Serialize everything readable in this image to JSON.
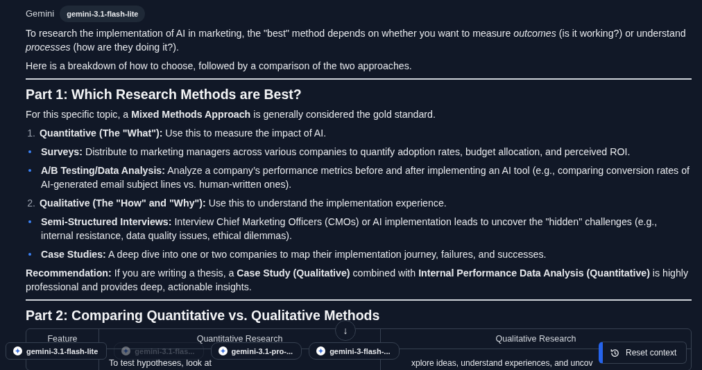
{
  "header": {
    "sender": "Gemini",
    "model_badge": "gemini-3.1-flash-lite"
  },
  "intro": [
    "To research the implementation of AI in marketing, the \"best\" method depends on whether you want to measure *outcomes* (is it working?) or understand *processes* (how are they doing it?).",
    "Here is a breakdown of how to choose, followed by a comparison of the two approaches."
  ],
  "sections": [
    {
      "heading": "Part 1: Which Research Methods are Best?",
      "blocks": [
        {
          "kind": "paragraph",
          "text": "For this specific topic, a **Mixed Methods Approach** is generally considered the gold standard."
        },
        {
          "kind": "numbered",
          "number": "1.",
          "text": "**Quantitative (The \"What\"):** Use this to measure the impact of AI."
        },
        {
          "kind": "bullet",
          "text": "**Surveys:** Distribute to marketing managers across various companies to quantify adoption rates, budget allocation, and perceived ROI."
        },
        {
          "kind": "bullet",
          "text": "**A/B Testing/Data Analysis:** Analyze a company’s performance metrics before and after implementing an AI tool (e.g., comparing conversion rates of AI-generated email subject lines vs. human-written ones)."
        },
        {
          "kind": "numbered",
          "number": "2.",
          "text": "**Qualitative (The \"How\" and \"Why\"):** Use this to understand the implementation experience."
        },
        {
          "kind": "bullet",
          "text": "**Semi-Structured Interviews:** Interview Chief Marketing Officers (CMOs) or AI implementation leads to uncover the \"hidden\" challenges (e.g., internal resistance, data quality issues, ethical dilemmas)."
        },
        {
          "kind": "bullet",
          "text": "**Case Studies:** A deep dive into one or two companies to map their implementation journey, failures, and successes."
        },
        {
          "kind": "paragraph",
          "text": "**Recommendation:** If you are writing a thesis, a **Case Study (Qualitative)** combined with **Internal Performance Data Analysis (Quantitative)** is highly professional and provides deep, actionable insights."
        }
      ]
    },
    {
      "heading": "Part 2: Comparing Quantitative vs. Qualitative Methods",
      "table": {
        "columns": [
          "Feature",
          "Quantitative Research",
          "Qualitative Research"
        ],
        "rows": [
          [
            "",
            "To test hypotheses, look at",
            "xplore ideas, understand experiences, and uncov"
          ]
        ]
      }
    }
  ],
  "scroll_button": {
    "label": "↓"
  },
  "model_chips": [
    {
      "label": "gemini-3.1-flash-lite",
      "disabled": false
    },
    {
      "label": "gemini-3.1-flas...",
      "disabled": true
    },
    {
      "label": "gemini-3.1-pro-...",
      "disabled": false
    },
    {
      "label": "gemini-3-flash-...",
      "disabled": false
    }
  ],
  "reset_button": {
    "label": "Reset context"
  }
}
